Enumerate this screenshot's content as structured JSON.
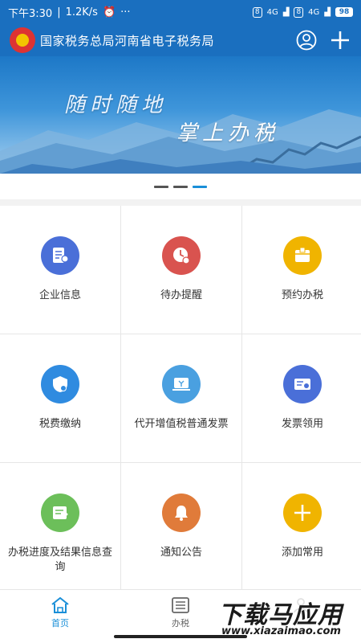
{
  "status_bar": {
    "time": "下午3:30",
    "speed": "1.2K/s",
    "signal1": "4G",
    "signal2": "4G",
    "battery": "98"
  },
  "header": {
    "title": "国家税务总局河南省电子税务局",
    "logo_icon": "tax-emblem-icon",
    "user_icon": "user-icon",
    "add_icon": "plus-icon"
  },
  "banner": {
    "line1": "随时随地",
    "line2": "掌上办税",
    "slides": 3,
    "active_slide": 3
  },
  "grid": [
    {
      "label": "企业信息",
      "icon": "company-info-icon",
      "color": "#4a6fd8"
    },
    {
      "label": "待办提醒",
      "icon": "clock-reminder-icon",
      "color": "#d9534f"
    },
    {
      "label": "预约办税",
      "icon": "appointment-icon",
      "color": "#f0b400"
    },
    {
      "label": "税费缴纳",
      "icon": "tax-payment-icon",
      "color": "#2f8be0"
    },
    {
      "label": "代开增值税普通发票",
      "icon": "invoice-issue-icon",
      "color": "#4aa0e0"
    },
    {
      "label": "发票领用",
      "icon": "invoice-receive-icon",
      "color": "#4a6fd8"
    },
    {
      "label": "办税进度及结果信息查询",
      "icon": "progress-query-icon",
      "color": "#6cbf5a"
    },
    {
      "label": "通知公告",
      "icon": "bell-notice-icon",
      "color": "#e07b3a"
    },
    {
      "label": "添加常用",
      "icon": "plus-icon",
      "color": "#f0b400"
    }
  ],
  "bottom_nav": [
    {
      "label": "首页",
      "icon": "home-icon",
      "active": true
    },
    {
      "label": "办税",
      "icon": "list-icon",
      "active": false
    },
    {
      "label": "",
      "icon": "user-icon",
      "active": false
    }
  ],
  "watermark": {
    "main": "下载马应用",
    "sub": "www.xiazaimao.com"
  }
}
